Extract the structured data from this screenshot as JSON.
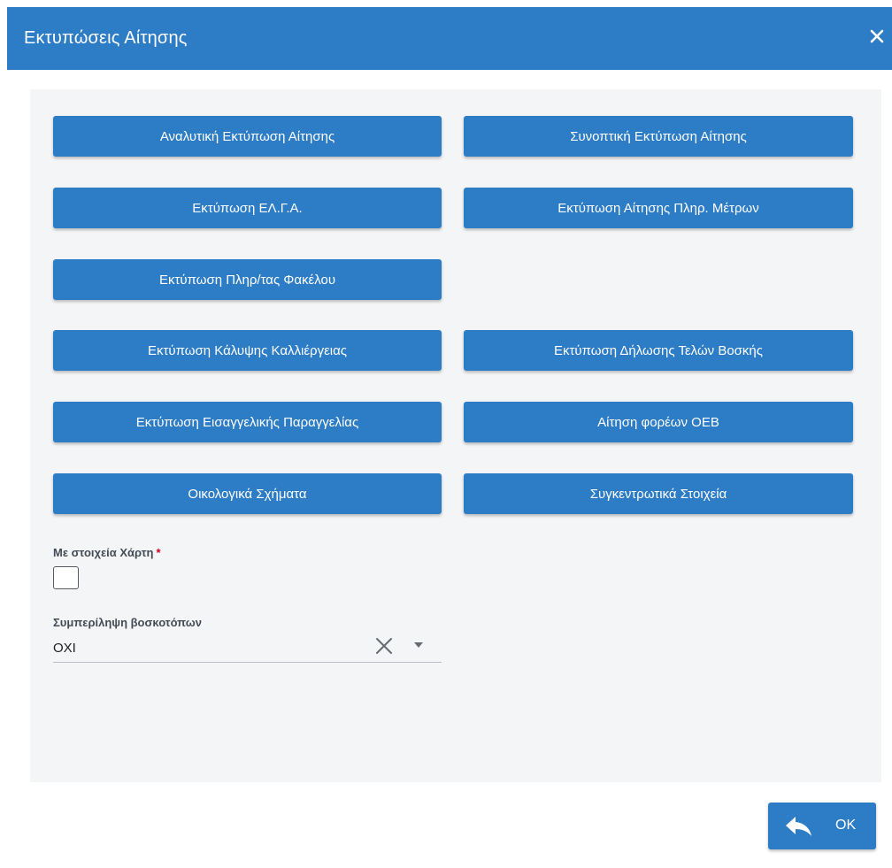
{
  "dialog": {
    "title": "Εκτυπώσεις Αίτησης",
    "close_icon": "close-icon"
  },
  "buttons": {
    "analytic": "Αναλυτική Εκτύπωση Αίτησης",
    "summary": "Συνοπτική Εκτύπωση Αίτησης",
    "elga": "Εκτύπωση ΕΛ.Γ.Α.",
    "measures": "Εκτύπωση Αίτησης Πληρ. Μέτρων",
    "folder": "Εκτύπωση Πληρ/τας Φακέλου",
    "crop_coverage": "Εκτύπωση Κάλυψης Καλλιέργειας",
    "grazing_fees": "Εκτύπωση Δήλωσης Τελών Βοσκής",
    "prosecutor_order": "Εκτύπωση Εισαγγελικής Παραγγελίας",
    "oeb": "Αίτηση φορέων ΟΕΒ",
    "eco_schemes": "Οικολογικά Σχήματα",
    "aggregate": "Συγκεντρωτικά Στοιχεία"
  },
  "map_field": {
    "label": "Με στοιχεία Χάρτη",
    "required_mark": "*",
    "checked": false
  },
  "pasture_field": {
    "label": "Συμπερίληψη βοσκοτόπων",
    "value": "ΟΧΙ",
    "clear_icon": "close-icon",
    "dropdown_icon": "caret-down-icon"
  },
  "footer": {
    "ok_label": "OK",
    "ok_icon": "reply-arrow-icon"
  },
  "colors": {
    "primary": "#2d7cc6",
    "panel": "#f4f5f7",
    "required": "#d0021b"
  }
}
